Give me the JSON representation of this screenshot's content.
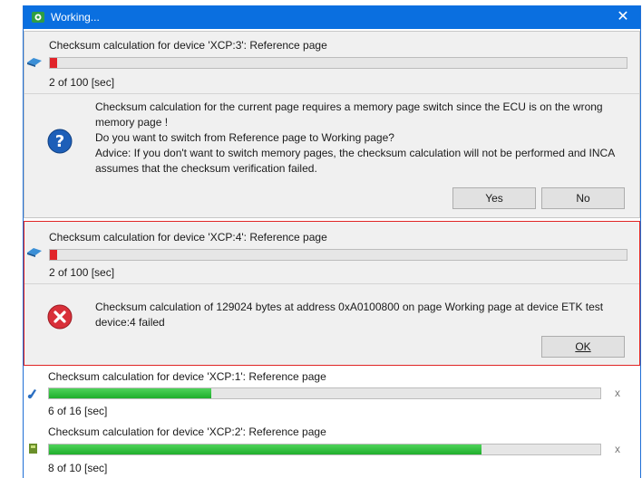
{
  "window": {
    "title": "Working...",
    "close_label": "✕"
  },
  "tasks": [
    {
      "title": "Checksum calculation for device 'XCP:3': Reference page",
      "progress": 0.012,
      "time": "2 of 100 [sec]",
      "message": {
        "lines": [
          "Checksum calculation for the current page requires a memory page switch since the ECU is on the wrong memory page !",
          "Do you want to switch from Reference page to Working page?",
          "Advice: If you don't want to switch memory pages, the checksum calculation will not be performed and INCA assumes that the checksum verification failed."
        ],
        "yes_label": "Yes",
        "no_label": "No"
      }
    },
    {
      "title": "Checksum calculation for device 'XCP:4': Reference page",
      "progress": 0.012,
      "time": "2 of 100 [sec]",
      "message": {
        "text": "Checksum calculation of 129024 bytes at address 0xA0100800 on page Working page at device ETK test device:4 failed",
        "ok_label": "OK"
      }
    },
    {
      "title": "Checksum calculation for device 'XCP:1': Reference page",
      "progress": 0.295,
      "time": "6 of 16 [sec]",
      "cancel_label": "x"
    },
    {
      "title": "Checksum calculation for device 'XCP:2': Reference page",
      "progress": 0.785,
      "time": "8 of 10 [sec]",
      "cancel_label": "x"
    }
  ],
  "colors": {
    "titlebar": "#0a6fe0",
    "error_border": "#e02424",
    "progress_red": "#e1242a",
    "progress_green": "#1fae2c"
  }
}
